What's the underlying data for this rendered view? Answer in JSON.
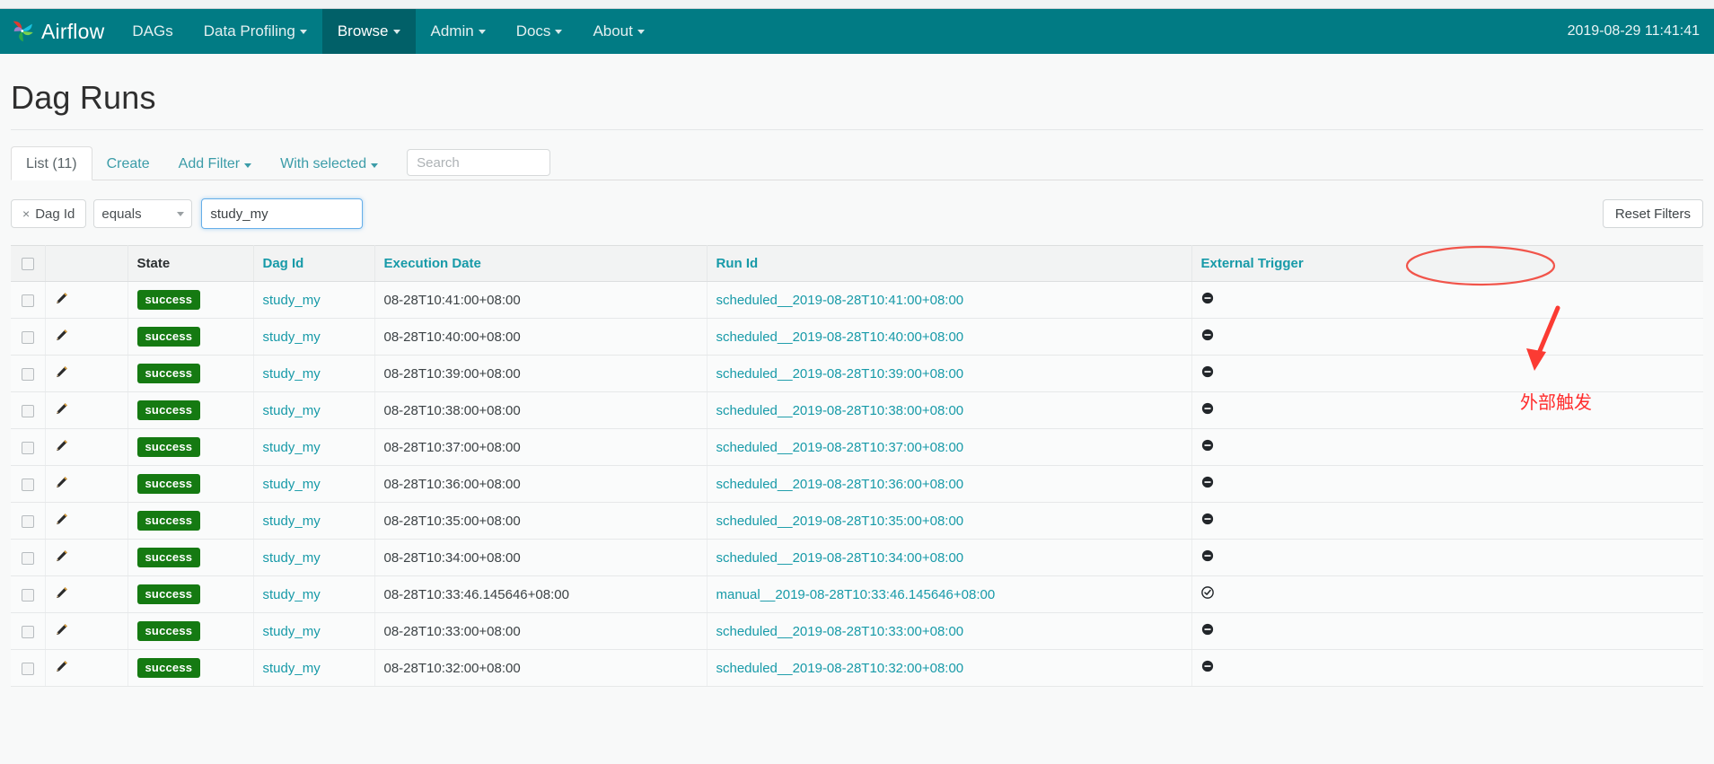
{
  "navbar": {
    "brand": "Airflow",
    "brand_logo_icon": "airflow-pinwheel-logo",
    "items": [
      {
        "label": "DAGs",
        "has_caret": false,
        "active": false
      },
      {
        "label": "Data Profiling",
        "has_caret": true,
        "active": false
      },
      {
        "label": "Browse",
        "has_caret": true,
        "active": true
      },
      {
        "label": "Admin",
        "has_caret": true,
        "active": false
      },
      {
        "label": "Docs",
        "has_caret": true,
        "active": false
      },
      {
        "label": "About",
        "has_caret": true,
        "active": false
      }
    ],
    "clock": "2019-08-29 11:41:41",
    "bg_color": "#017b84",
    "active_bg_color": "#016068"
  },
  "page": {
    "title": "Dag Runs"
  },
  "toolbar": {
    "tabs": [
      {
        "label": "List (11)",
        "active": true
      },
      {
        "label": "Create",
        "active": false
      },
      {
        "label": "Add Filter",
        "active": false,
        "has_caret": true
      },
      {
        "label": "With selected",
        "active": false,
        "has_caret": true
      }
    ],
    "search_placeholder": "Search",
    "search_value": ""
  },
  "filters": {
    "chip_remove_glyph": "×",
    "chip_label": "Dag Id",
    "operator": "equals",
    "value": "study_my",
    "reset_label": "Reset Filters"
  },
  "table": {
    "columns": [
      {
        "key": "check",
        "label": "",
        "link": false
      },
      {
        "key": "edit",
        "label": "",
        "link": false
      },
      {
        "key": "state",
        "label": "State",
        "link": false
      },
      {
        "key": "dag_id",
        "label": "Dag Id",
        "link": true
      },
      {
        "key": "exec",
        "label": "Execution Date",
        "link": true
      },
      {
        "key": "run_id",
        "label": "Run Id",
        "link": true
      },
      {
        "key": "trigger",
        "label": "External Trigger",
        "link": true
      }
    ],
    "edit_icon": "pencil-icon",
    "trigger_icons": {
      "false": "minus-circle-icon",
      "true": "check-circle-icon"
    },
    "rows": [
      {
        "state": "success",
        "dag_id": "study_my",
        "exec": "08-28T10:41:00+08:00",
        "run_id": "scheduled__2019-08-28T10:41:00+08:00",
        "external_trigger": false
      },
      {
        "state": "success",
        "dag_id": "study_my",
        "exec": "08-28T10:40:00+08:00",
        "run_id": "scheduled__2019-08-28T10:40:00+08:00",
        "external_trigger": false
      },
      {
        "state": "success",
        "dag_id": "study_my",
        "exec": "08-28T10:39:00+08:00",
        "run_id": "scheduled__2019-08-28T10:39:00+08:00",
        "external_trigger": false
      },
      {
        "state": "success",
        "dag_id": "study_my",
        "exec": "08-28T10:38:00+08:00",
        "run_id": "scheduled__2019-08-28T10:38:00+08:00",
        "external_trigger": false
      },
      {
        "state": "success",
        "dag_id": "study_my",
        "exec": "08-28T10:37:00+08:00",
        "run_id": "scheduled__2019-08-28T10:37:00+08:00",
        "external_trigger": false
      },
      {
        "state": "success",
        "dag_id": "study_my",
        "exec": "08-28T10:36:00+08:00",
        "run_id": "scheduled__2019-08-28T10:36:00+08:00",
        "external_trigger": false
      },
      {
        "state": "success",
        "dag_id": "study_my",
        "exec": "08-28T10:35:00+08:00",
        "run_id": "scheduled__2019-08-28T10:35:00+08:00",
        "external_trigger": false
      },
      {
        "state": "success",
        "dag_id": "study_my",
        "exec": "08-28T10:34:00+08:00",
        "run_id": "scheduled__2019-08-28T10:34:00+08:00",
        "external_trigger": false
      },
      {
        "state": "success",
        "dag_id": "study_my",
        "exec": "08-28T10:33:46.145646+08:00",
        "run_id": "manual__2019-08-28T10:33:46.145646+08:00",
        "external_trigger": true
      },
      {
        "state": "success",
        "dag_id": "study_my",
        "exec": "08-28T10:33:00+08:00",
        "run_id": "scheduled__2019-08-28T10:33:00+08:00",
        "external_trigger": false
      },
      {
        "state": "success",
        "dag_id": "study_my",
        "exec": "08-28T10:32:00+08:00",
        "run_id": "scheduled__2019-08-28T10:32:00+08:00",
        "external_trigger": false
      }
    ]
  },
  "annotations": {
    "color": "#ff2d2d",
    "ellipse_target": "External Trigger",
    "arrow": "down-arrow",
    "note_text": "外部触发"
  }
}
